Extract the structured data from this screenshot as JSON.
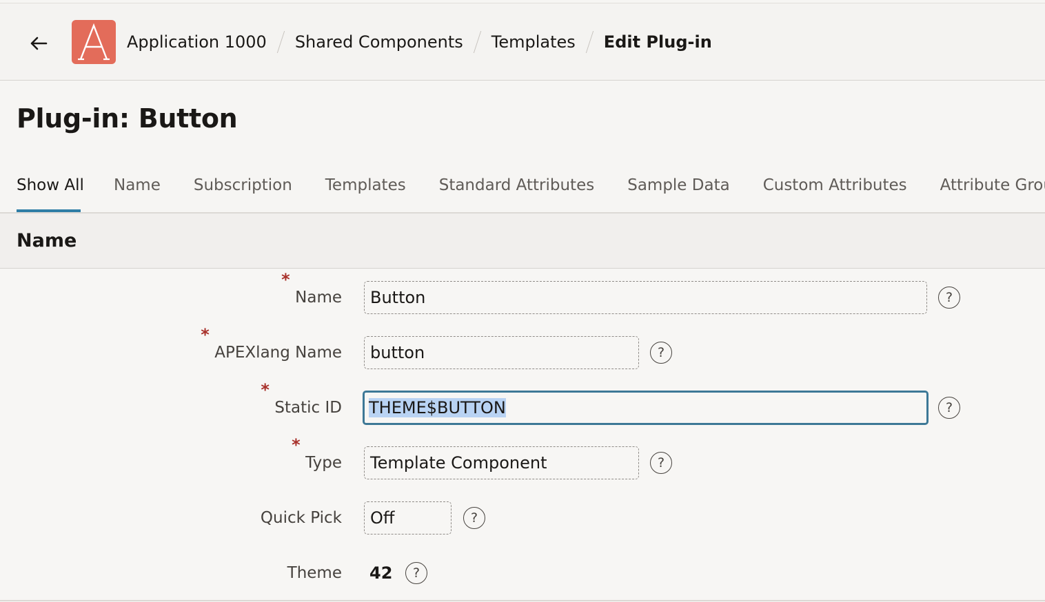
{
  "header": {
    "back_icon": "arrow-left-icon",
    "logo_letter": "A",
    "logo_color": "#e36c5a",
    "breadcrumbs": [
      {
        "label": "Application 1000"
      },
      {
        "label": "Shared Components"
      },
      {
        "label": "Templates"
      },
      {
        "label": "Edit Plug-in"
      }
    ]
  },
  "page": {
    "title": "Plug-in: Button"
  },
  "tabs": [
    {
      "label": "Show All",
      "active": true
    },
    {
      "label": "Name"
    },
    {
      "label": "Subscription"
    },
    {
      "label": "Templates"
    },
    {
      "label": "Standard Attributes"
    },
    {
      "label": "Sample Data"
    },
    {
      "label": "Custom Attributes"
    },
    {
      "label": "Attribute Groups"
    }
  ],
  "section": {
    "title": "Name"
  },
  "form": {
    "required_mark": "*",
    "help_glyph": "?",
    "name": {
      "label": "Name",
      "value": "Button"
    },
    "apexlang_name": {
      "label": "APEXlang Name",
      "value": "button"
    },
    "static_id": {
      "label": "Static ID",
      "value": "THEME$BUTTON"
    },
    "type": {
      "label": "Type",
      "value": "Template Component"
    },
    "quick_pick": {
      "label": "Quick Pick",
      "value": "Off"
    },
    "theme": {
      "label": "Theme",
      "value": "42"
    }
  },
  "colors": {
    "accent": "#2f7ea6",
    "focus_border": "#3d7896",
    "required": "#a8312b",
    "selection": "#b9d3f3"
  }
}
